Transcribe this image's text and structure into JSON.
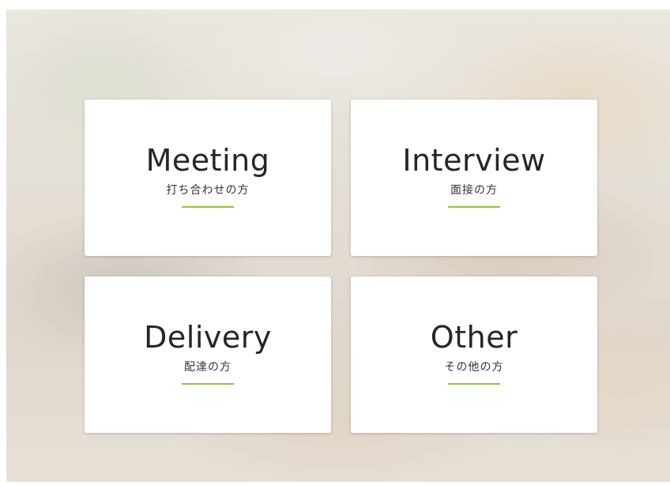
{
  "theme": {
    "accent": "#8dc63f",
    "card_background": "#ffffff",
    "text_color": "#262626"
  },
  "background": {
    "description_icon": "blurred-office-photo"
  },
  "cards": [
    {
      "title": "Meeting",
      "subtitle": "打ち合わせの方"
    },
    {
      "title": "Interview",
      "subtitle": "面接の方"
    },
    {
      "title": "Delivery",
      "subtitle": "配達の方"
    },
    {
      "title": "Other",
      "subtitle": "その他の方"
    }
  ]
}
